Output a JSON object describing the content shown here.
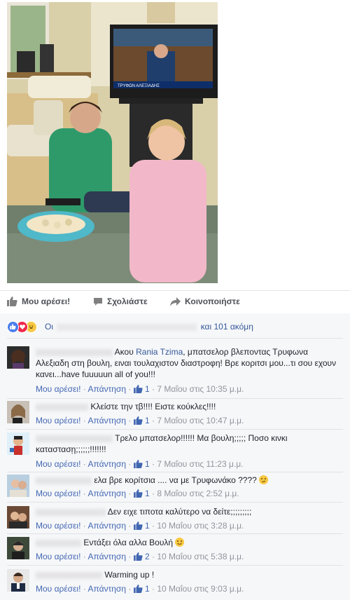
{
  "actions": {
    "like": "Μου αρέσει!",
    "comment": "Σχολιάστε",
    "share": "Κοινοποιήστε"
  },
  "reactions": {
    "prefix": "Οι",
    "suffix": "και 101 ακόμη"
  },
  "comments": [
    {
      "text_pre": "Ακου",
      "mention": "Rania Tzima",
      "text_post": ", μπατσελορ βλεποντας Τρυφωνα Αλεξιαδη στη βουλη, ειναι τουλαχιστον διαστροφη! Βρε κοριτσι μου...τι σου εχουν κανει...have fuuuuun all of you!!!",
      "like_label": "Μου αρέσει!",
      "reply_label": "Απάντηση",
      "likes": "1",
      "time": "7 Μαΐου στις 10:35 μ.μ."
    },
    {
      "text_pre": "Κλείστε την τβ!!!! Ειστε κούκλες!!!!",
      "mention": "",
      "text_post": "",
      "like_label": "Μου αρέσει!",
      "reply_label": "Απάντηση",
      "likes": "1",
      "time": "7 Μαΐου στις 10:47 μ.μ."
    },
    {
      "text_pre": "Τρελο μπατσελορ!!!!!! Μα βουλη;;;;; Ποσο κινκι καταστασῃ;;;;;;!!!!!!!",
      "mention": "",
      "text_post": "",
      "like_label": "Μου αρέσει!",
      "reply_label": "Απάντηση",
      "likes": "1",
      "time": "7 Μαΐου στις 11:23 μ.μ."
    },
    {
      "text_pre": "ελα βρε κορίτσια .... να με Τρυφωνάκο ????",
      "mention": "",
      "text_post": "",
      "like_label": "Μου αρέσει!",
      "reply_label": "Απάντηση",
      "likes": "1",
      "time": "8 Μαΐου στις 2:52 μ.μ."
    },
    {
      "text_pre": "Δεν ειχε τιποτα καλύτερο να δείτε;;;;;;;;;",
      "mention": "",
      "text_post": "",
      "like_label": "Μου αρέσει!",
      "reply_label": "Απάντηση",
      "likes": "1",
      "time": "10 Μαΐου στις 3:28 μ.μ."
    },
    {
      "text_pre": "Εντάξει όλα αλλα Βουλή",
      "mention": "",
      "text_post": "",
      "like_label": "Μου αρέσει!",
      "reply_label": "Απάντηση",
      "likes": "2",
      "time": "10 Μαΐου στις 5:38 μ.μ."
    },
    {
      "text_pre": "Warming up !",
      "mention": "",
      "text_post": "",
      "like_label": "Μου αρέσει!",
      "reply_label": "Απάντηση",
      "likes": "1",
      "time": "10 Μαΐου στις 9:03 μ.μ."
    }
  ],
  "tv": {
    "caption": "ΤΡΥΦΩΝ ΑΛΕΞΙΑΔΗΣ"
  },
  "colors": {
    "link": "#365899",
    "meta": "#90949c",
    "like_blue": "#4267b2"
  }
}
